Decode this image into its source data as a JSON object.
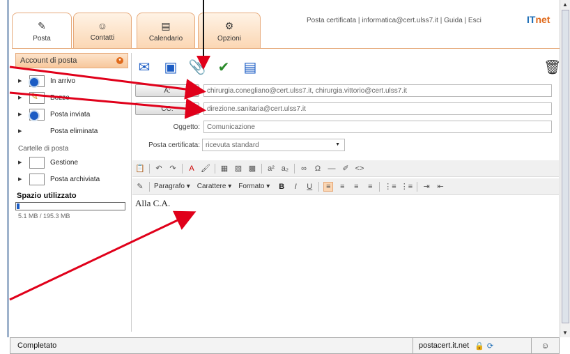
{
  "tabs": [
    {
      "label": "Posta",
      "icon": "pen-icon",
      "active": true
    },
    {
      "label": "Contatti",
      "icon": "contacts-icon",
      "active": false
    },
    {
      "label": "Calendario",
      "icon": "calendar-icon",
      "active": false
    },
    {
      "label": "Opzioni",
      "icon": "options-icon",
      "active": false
    }
  ],
  "toplinks": "Posta certificata | informatica@cert.ulss7.it | Guida | Esci",
  "logo": {
    "left": "IT",
    "right": "net"
  },
  "sidebar": {
    "account_header": "Account di posta",
    "folders": [
      {
        "label": "In arrivo",
        "icon": "inbox-icon"
      },
      {
        "label": "Bozze",
        "icon": "drafts-icon"
      },
      {
        "label": "Posta inviata",
        "icon": "sent-icon"
      },
      {
        "label": "Posta eliminata",
        "icon": "trash-folder-icon"
      }
    ],
    "mail_folders_label": "Cartelle di posta",
    "custom_folders": [
      {
        "label": "Gestione"
      },
      {
        "label": "Posta archiviata"
      }
    ],
    "space_label": "Spazio utilizzato",
    "space_value": "5.1 MB / 195.3 MB",
    "space_fraction": 0.026
  },
  "compose": {
    "to_button": "A:",
    "to_value": "chirurgia.conegliano@cert.ulss7.it, chirurgia.vittorio@cert.ulss7.it",
    "cc_button": "CC:",
    "cc_value": "direzione.sanitaria@cert.ulss7.it",
    "subject_label": "Oggetto:",
    "subject_value": "Comunicazione",
    "pec_label": "Posta certificata:",
    "pec_value": "ricevuta standard",
    "body": "Alla C.A."
  },
  "editor_toolbar": {
    "paragraph": "Paragrafo",
    "font": "Carattere",
    "format": "Formato",
    "bold": "B",
    "italic": "I",
    "underline": "U"
  },
  "status": {
    "left": "Completato",
    "host": "postacert.it.net"
  },
  "colors": {
    "tab_accent": "#e6a97a",
    "brand_blue": "#1a6bb5",
    "brand_orange": "#e06a1b",
    "arrow_red": "#e0001a"
  }
}
